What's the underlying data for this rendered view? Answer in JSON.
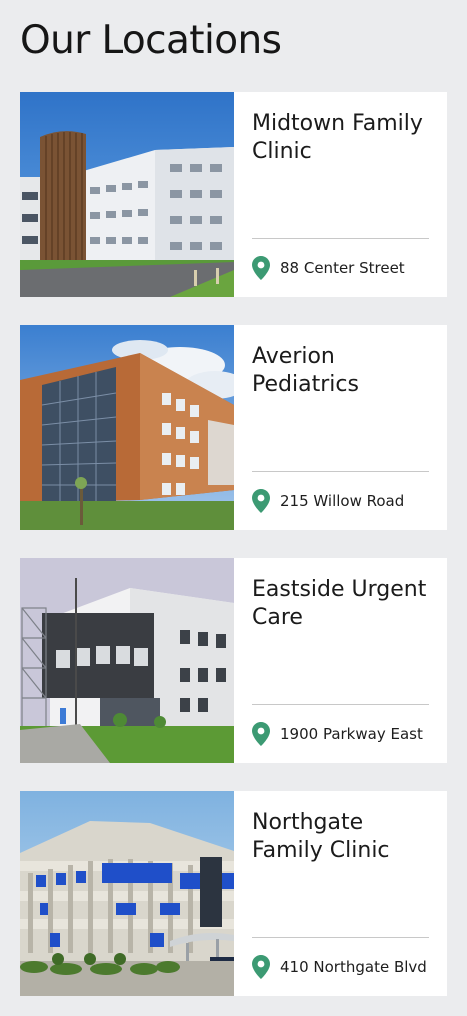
{
  "page": {
    "title": "Our Locations"
  },
  "colors": {
    "accent": "#3c9a73",
    "background": "#ebecee",
    "card": "#ffffff"
  },
  "icons": {
    "address": "map-pin-icon"
  },
  "locations": [
    {
      "name": "Midtown Family Clinic",
      "address": "88 Center Street"
    },
    {
      "name": "Averion Pediatrics",
      "address": "215 Willow Road"
    },
    {
      "name": "Eastside Urgent Care",
      "address": "1900 Parkway East"
    },
    {
      "name": "Northgate Family Clinic",
      "address": "410 Northgate Blvd"
    }
  ]
}
